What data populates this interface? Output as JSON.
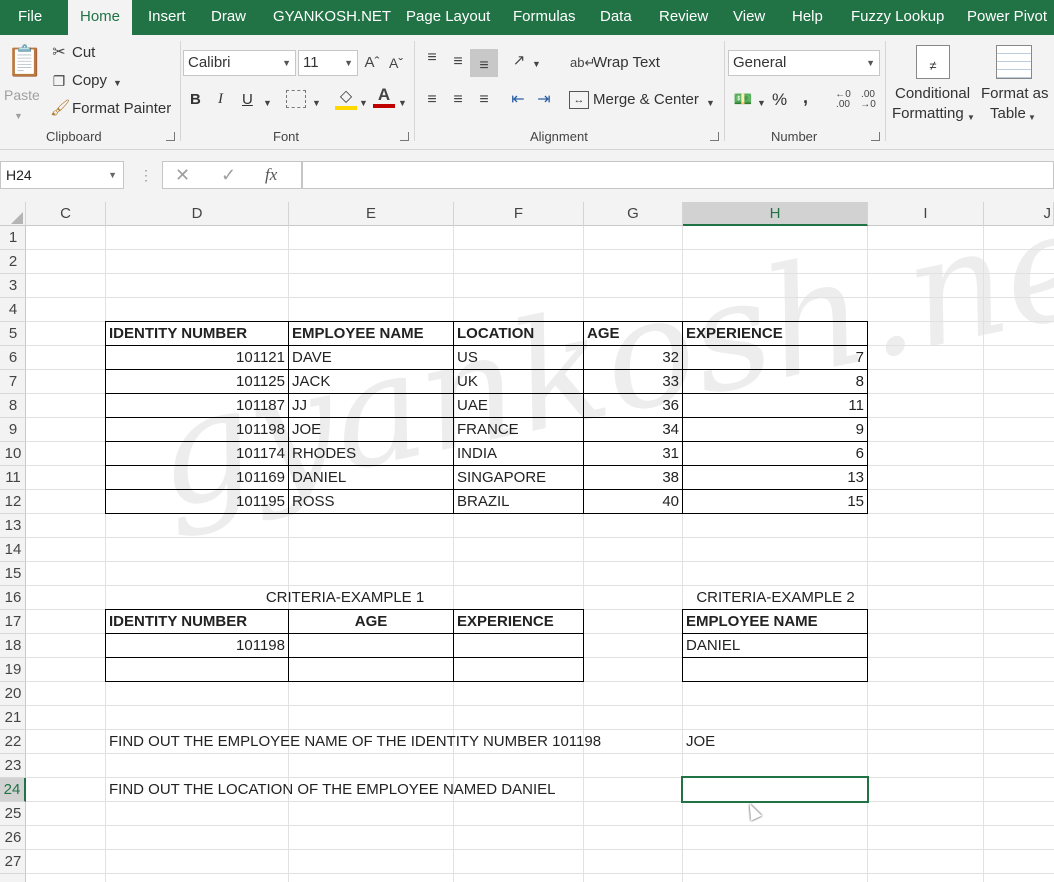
{
  "tabs": [
    "File",
    "Home",
    "Insert",
    "Draw",
    "GYANKOSH.NET",
    "Page Layout",
    "Formulas",
    "Data",
    "Review",
    "View",
    "Help",
    "Fuzzy Lookup",
    "Power Pivot"
  ],
  "ribbon": {
    "clipboard": {
      "paste": "Paste",
      "cut": "Cut",
      "copy": "Copy",
      "format_painter": "Format Painter",
      "label": "Clipboard"
    },
    "font": {
      "name": "Calibri",
      "size": "11",
      "bold": "B",
      "italic": "I",
      "underline": "U",
      "label": "Font"
    },
    "alignment": {
      "wrap_text": "Wrap Text",
      "merge_center": "Merge & Center",
      "label": "Alignment"
    },
    "number": {
      "format": "General",
      "percent": "%",
      "comma": ",",
      "label": "Number"
    },
    "styles": {
      "conditional_1": "Conditional",
      "conditional_2": "Formatting",
      "format_as_1": "Format as",
      "format_as_2": "Table"
    }
  },
  "formula_bar": {
    "name_box": "H24",
    "fx": "fx",
    "value": ""
  },
  "columns": [
    "C",
    "D",
    "E",
    "F",
    "G",
    "H",
    "I",
    "J"
  ],
  "rows": [
    "1",
    "2",
    "3",
    "4",
    "5",
    "6",
    "7",
    "8",
    "9",
    "10",
    "11",
    "12",
    "13",
    "14",
    "15",
    "16",
    "17",
    "18",
    "19",
    "20",
    "21",
    "22",
    "23",
    "24",
    "25",
    "26",
    "27"
  ],
  "table": {
    "headers": [
      "IDENTITY NUMBER",
      "EMPLOYEE NAME",
      "LOCATION",
      "AGE",
      "EXPERIENCE"
    ],
    "rows": [
      [
        "101121",
        "DAVE",
        "US",
        "32",
        "7"
      ],
      [
        "101125",
        "JACK",
        "UK",
        "33",
        "8"
      ],
      [
        "101187",
        "JJ",
        "UAE",
        "36",
        "11"
      ],
      [
        "101198",
        "JOE",
        "FRANCE",
        "34",
        "9"
      ],
      [
        "101174",
        "RHODES",
        "INDIA",
        "31",
        "6"
      ],
      [
        "101169",
        "DANIEL",
        "SINGAPORE",
        "38",
        "13"
      ],
      [
        "101195",
        "ROSS",
        "BRAZIL",
        "40",
        "15"
      ]
    ]
  },
  "criteria1": {
    "title": "CRITERIA-EXAMPLE 1",
    "headers": [
      "IDENTITY NUMBER",
      "AGE",
      "EXPERIENCE"
    ],
    "values": [
      "101198",
      "",
      ""
    ]
  },
  "criteria2": {
    "title": "CRITERIA-EXAMPLE 2",
    "header": "EMPLOYEE NAME",
    "value": "DANIEL"
  },
  "questions": {
    "q1": "FIND OUT THE EMPLOYEE NAME OF THE IDENTITY NUMBER 101198",
    "a1": "JOE",
    "q2": "FIND OUT THE LOCATION OF THE EMPLOYEE NAMED DANIEL",
    "a2": ""
  },
  "watermark": "gyankosh.net",
  "colors": {
    "ribbon_green": "#217346",
    "ribbon_bg": "#f3f3f3",
    "grid_line": "#e1e1e1"
  }
}
